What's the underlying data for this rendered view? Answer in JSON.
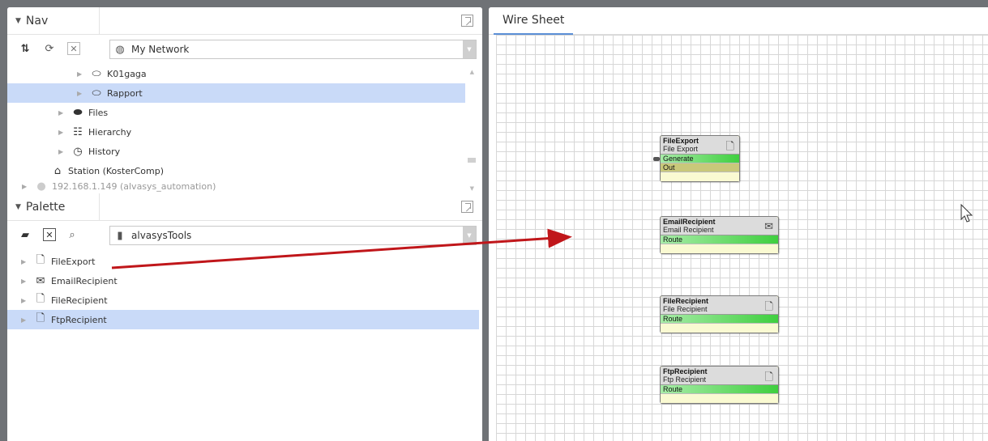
{
  "nav": {
    "title": "Nav",
    "network_select": "My Network",
    "tree": [
      {
        "label": "K01gaga",
        "icon": "folder-icon",
        "selected": false
      },
      {
        "label": "Rapport",
        "icon": "folder-icon",
        "selected": true
      },
      {
        "label": "Files",
        "icon": "files-icon",
        "selected": false
      },
      {
        "label": "Hierarchy",
        "icon": "hierarchy-icon",
        "selected": false
      },
      {
        "label": "History",
        "icon": "history-icon",
        "selected": false
      },
      {
        "label": "Station (KosterComp)",
        "icon": "station-icon",
        "selected": false
      },
      {
        "label": "192.168.1.149 (alvasys_automation)",
        "icon": "host-icon",
        "selected": false
      }
    ]
  },
  "palette": {
    "title": "Palette",
    "module_select": "alvasysTools",
    "items": [
      {
        "label": "FileExport",
        "icon": "file-export-icon",
        "selected": false
      },
      {
        "label": "EmailRecipient",
        "icon": "email-icon",
        "selected": false
      },
      {
        "label": "FileRecipient",
        "icon": "file-icon",
        "selected": false
      },
      {
        "label": "FtpRecipient",
        "icon": "ftp-icon",
        "selected": true
      }
    ]
  },
  "wiresheet": {
    "title": "Wire Sheet",
    "blocks": [
      {
        "name": "FileExport",
        "type": "File Export",
        "icon": "file-export-icon",
        "slots": [
          "Generate",
          "Out"
        ]
      },
      {
        "name": "EmailRecipient",
        "type": "Email Recipient",
        "icon": "email-icon",
        "slots": [
          "Route"
        ]
      },
      {
        "name": "FileRecipient",
        "type": "File Recipient",
        "icon": "file-icon",
        "slots": [
          "Route"
        ]
      },
      {
        "name": "FtpRecipient",
        "type": "Ftp Recipient",
        "icon": "ftp-icon",
        "slots": [
          "Route"
        ]
      }
    ]
  },
  "colors": {
    "selection": "#c9daf8",
    "slot_green": "#3fcf3f",
    "slot_olive": "#c9c87a",
    "block_body": "#fafad2",
    "drag_arrow": "#c0161a",
    "tab_underline": "#5b8fd6"
  }
}
